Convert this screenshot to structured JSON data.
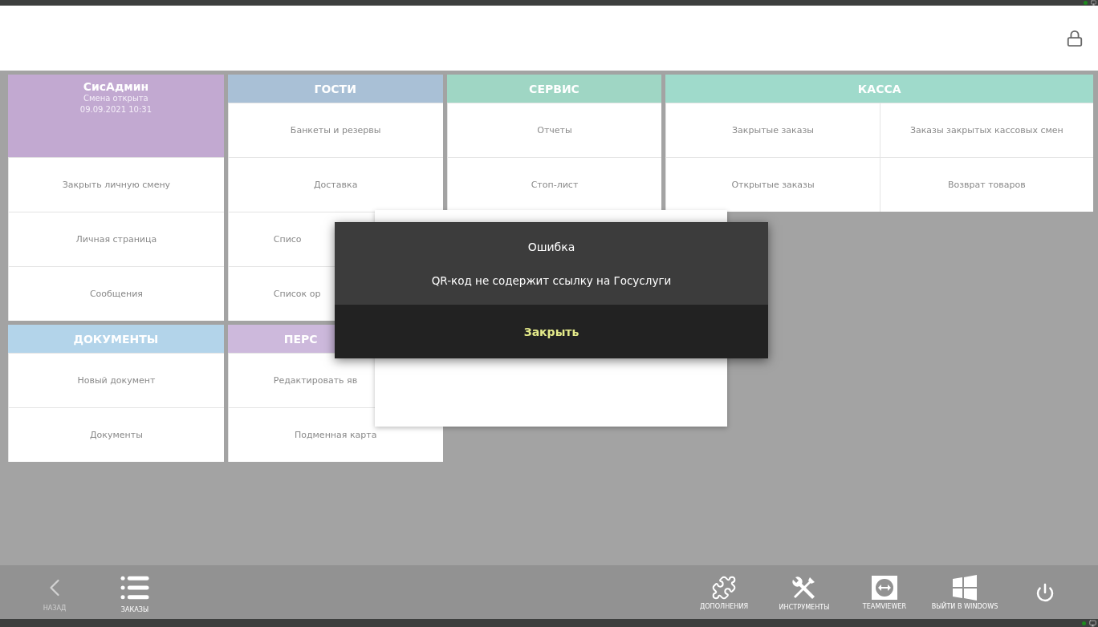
{
  "columns": [
    {
      "sections": [
        {
          "kind": "profile",
          "title": "СисАдмин",
          "color": "#c2a9d1",
          "status": [
            "Смена открыта",
            "09.09.2021 10:31"
          ],
          "items": [
            {
              "label": "Закрыть личную смену",
              "kind": "full"
            },
            {
              "label": "Личная страница",
              "kind": "full"
            },
            {
              "label": "Сообщения",
              "kind": "full"
            }
          ]
        },
        {
          "kind": "menu",
          "title": "ДОКУМЕНТЫ",
          "color": "#b3d4ea",
          "items": [
            {
              "label": "Новый документ",
              "kind": "full"
            },
            {
              "label": "Документы",
              "kind": "full"
            }
          ]
        }
      ]
    },
    {
      "sections": [
        {
          "kind": "menu",
          "title": "ГОСТИ",
          "color": "#a9c0d6",
          "items": [
            {
              "label": "Банкеты и резервы",
              "kind": "full"
            },
            {
              "label": "Доставка",
              "kind": "full"
            },
            {
              "label": "Списо",
              "kind": "partial"
            },
            {
              "label": "Список ор",
              "kind": "partial"
            }
          ]
        },
        {
          "kind": "partial",
          "title": "ПЕРС",
          "color": "#cdb9dc",
          "items": [
            {
              "label": "Редактировать яв",
              "kind": "partial"
            },
            {
              "label": "Подменная карта",
              "kind": "full"
            }
          ]
        }
      ]
    },
    {
      "sections": [
        {
          "kind": "menu",
          "title": "СЕРВИС",
          "color": "#9fd6c4",
          "items": [
            {
              "label": "Отчеты",
              "kind": "full"
            },
            {
              "label": "Стоп-лист",
              "kind": "full"
            }
          ]
        }
      ]
    },
    {
      "wide": true,
      "sections": [
        {
          "kind": "menu",
          "title": "КАССА",
          "color": "#9fdacb",
          "items": [
            {
              "label": "Закрытые заказы",
              "kind": "full"
            },
            {
              "label": "Заказы закрытых кассовых смен",
              "kind": "full"
            },
            {
              "label": "Открытые заказы",
              "kind": "full"
            },
            {
              "label": "Возврат товаров",
              "kind": "full"
            }
          ]
        }
      ]
    }
  ],
  "dialog": {
    "title": "Ошибка",
    "message": "QR-код не содержит ссылку на Госуслуги",
    "button": "Закрыть"
  },
  "toolbar": {
    "left": [
      {
        "kind": "back",
        "label": "НАЗАД",
        "disabled": true
      },
      {
        "kind": "list",
        "label": "ЗАКАЗЫ",
        "disabled": false
      }
    ],
    "right": [
      {
        "kind": "puzzle",
        "label": "ДОПОЛНЕНИЯ",
        "disabled": false
      },
      {
        "kind": "tools",
        "label": "ИНСТРУМЕНТЫ",
        "disabled": false
      },
      {
        "kind": "teamviewer",
        "label": "TEAMVIEWER",
        "disabled": false
      },
      {
        "kind": "windows",
        "label": "ВЫЙТИ В WINDOWS",
        "disabled": false
      },
      {
        "kind": "power",
        "disabled": false
      }
    ]
  }
}
